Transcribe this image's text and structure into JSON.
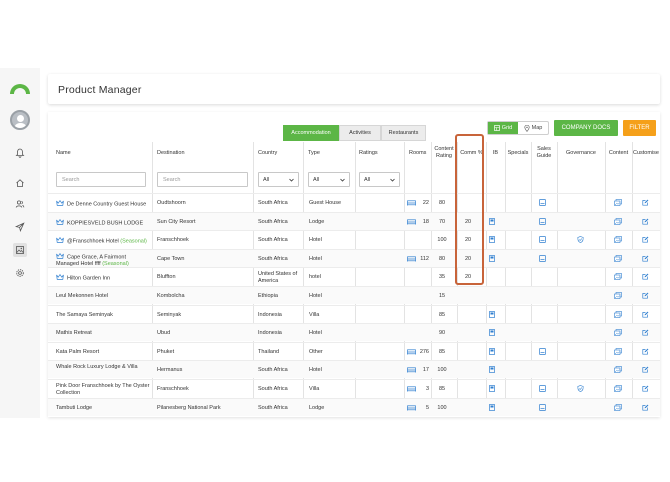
{
  "app": {
    "page_title": "Product Manager"
  },
  "colors": {
    "accent_green": "#5cb646",
    "filter_orange": "#f5a01a",
    "highlight": "#c8643a",
    "icon_blue": "#2f7fd0"
  },
  "sidebar": {
    "items": [
      {
        "icon": "bell-icon"
      },
      {
        "icon": "home-icon"
      },
      {
        "icon": "users-icon"
      },
      {
        "icon": "send-icon"
      },
      {
        "icon": "image-icon"
      },
      {
        "icon": "gear-icon"
      }
    ]
  },
  "tabs": [
    {
      "label": "Accommodation",
      "active": true
    },
    {
      "label": "Activities",
      "active": false
    },
    {
      "label": "Restaurants",
      "active": false
    }
  ],
  "toolbar": {
    "grid_label": "Grid",
    "map_label": "Map",
    "company_docs_label": "COMPANY DOCS",
    "filter_label": "FILTER"
  },
  "table": {
    "headers": {
      "name": "Name",
      "destination": "Destination",
      "country": "Country",
      "type": "Type",
      "ratings": "Ratings",
      "rooms": "Rooms",
      "content_rating": "Content Rating",
      "comm": "Comm %",
      "ib": "IB",
      "specials": "Specials",
      "sales_guide": "Sales Guide",
      "governance": "Governance",
      "content": "Content",
      "customise": "Customise"
    },
    "filters": {
      "name_placeholder": "Search",
      "destination_placeholder": "Search",
      "country_value": "All",
      "type_value": "All",
      "ratings_value": "All"
    },
    "rows": [
      {
        "crown": true,
        "name": "De Denne Country Guest House",
        "seasonal": "",
        "destination": "Oudtshoorn",
        "country": "South Africa",
        "type": "Guest House",
        "rooms": "22",
        "content_rating": "80",
        "comm": "",
        "ib": false,
        "sales_guide": true,
        "governance": false
      },
      {
        "crown": true,
        "name": "KOPPIESVELD BUSH LODGE",
        "seasonal": "",
        "destination": "Sun City Resort",
        "country": "South Africa",
        "type": "Lodge",
        "rooms": "18",
        "content_rating": "70",
        "comm": "20",
        "ib": true,
        "sales_guide": true,
        "governance": false
      },
      {
        "crown": true,
        "name": "@Franschhoek Hotel",
        "seasonal": "(Seasonal)",
        "destination": "Franschhoek",
        "country": "South Africa",
        "type": "Hotel",
        "rooms": "",
        "content_rating": "100",
        "comm": "20",
        "ib": true,
        "sales_guide": true,
        "governance": true
      },
      {
        "crown": true,
        "name": "Cape Grace, A Fairmont Managed Hotel ffff",
        "seasonal": "(Seasonal)",
        "destination": "Cape Town",
        "country": "South Africa",
        "type": "Hotel",
        "rooms": "112",
        "content_rating": "80",
        "comm": "20",
        "ib": true,
        "sales_guide": true,
        "governance": false
      },
      {
        "crown": true,
        "name": "Hilton Garden Inn",
        "seasonal": "",
        "destination": "Bluffton",
        "country": "United States of America",
        "type": "hotel",
        "rooms": "",
        "content_rating": "35",
        "comm": "20",
        "ib": false,
        "sales_guide": false,
        "governance": false
      },
      {
        "crown": false,
        "name": "Leul Mekonnen Hotel",
        "seasonal": "",
        "destination": "Kombolcha",
        "country": "Ethiopia",
        "type": "Hotel",
        "rooms": "",
        "content_rating": "15",
        "comm": "",
        "ib": false,
        "sales_guide": false,
        "governance": false
      },
      {
        "crown": false,
        "name": "The Samaya Seminyak",
        "seasonal": "",
        "destination": "Seminyak",
        "country": "Indonesia",
        "type": "Villa",
        "rooms": "",
        "content_rating": "85",
        "comm": "",
        "ib": true,
        "sales_guide": false,
        "governance": false
      },
      {
        "crown": false,
        "name": "Mathis Retreat",
        "seasonal": "",
        "destination": "Ubud",
        "country": "Indonesia",
        "type": "Hotel",
        "rooms": "",
        "content_rating": "90",
        "comm": "",
        "ib": true,
        "sales_guide": false,
        "governance": false
      },
      {
        "crown": false,
        "name": "Kata Palm Resort",
        "seasonal": "",
        "destination": "Phuket",
        "country": "Thailand",
        "type": "Other",
        "rooms": "276",
        "content_rating": "85",
        "comm": "",
        "ib": true,
        "sales_guide": true,
        "governance": false
      },
      {
        "crown": false,
        "name": "Whale Rock Luxury Lodge & Villa",
        "seasonal": "",
        "destination": "Hermanus",
        "country": "South Africa",
        "type": "Hotel",
        "rooms": "17",
        "content_rating": "100",
        "comm": "",
        "ib": true,
        "sales_guide": false,
        "governance": false
      },
      {
        "crown": false,
        "name": "Pink Door Franschhoek by The Oyster Collection",
        "seasonal": "",
        "destination": "Franschhoek",
        "country": "South Africa",
        "type": "Villa",
        "rooms": "3",
        "content_rating": "85",
        "comm": "",
        "ib": true,
        "sales_guide": true,
        "governance": true
      },
      {
        "crown": false,
        "name": "Tambuti Lodge",
        "seasonal": "",
        "destination": "Pilanesberg National Park",
        "country": "South Africa",
        "type": "Lodge",
        "rooms": "5",
        "content_rating": "100",
        "comm": "",
        "ib": true,
        "sales_guide": true,
        "governance": false
      }
    ]
  }
}
